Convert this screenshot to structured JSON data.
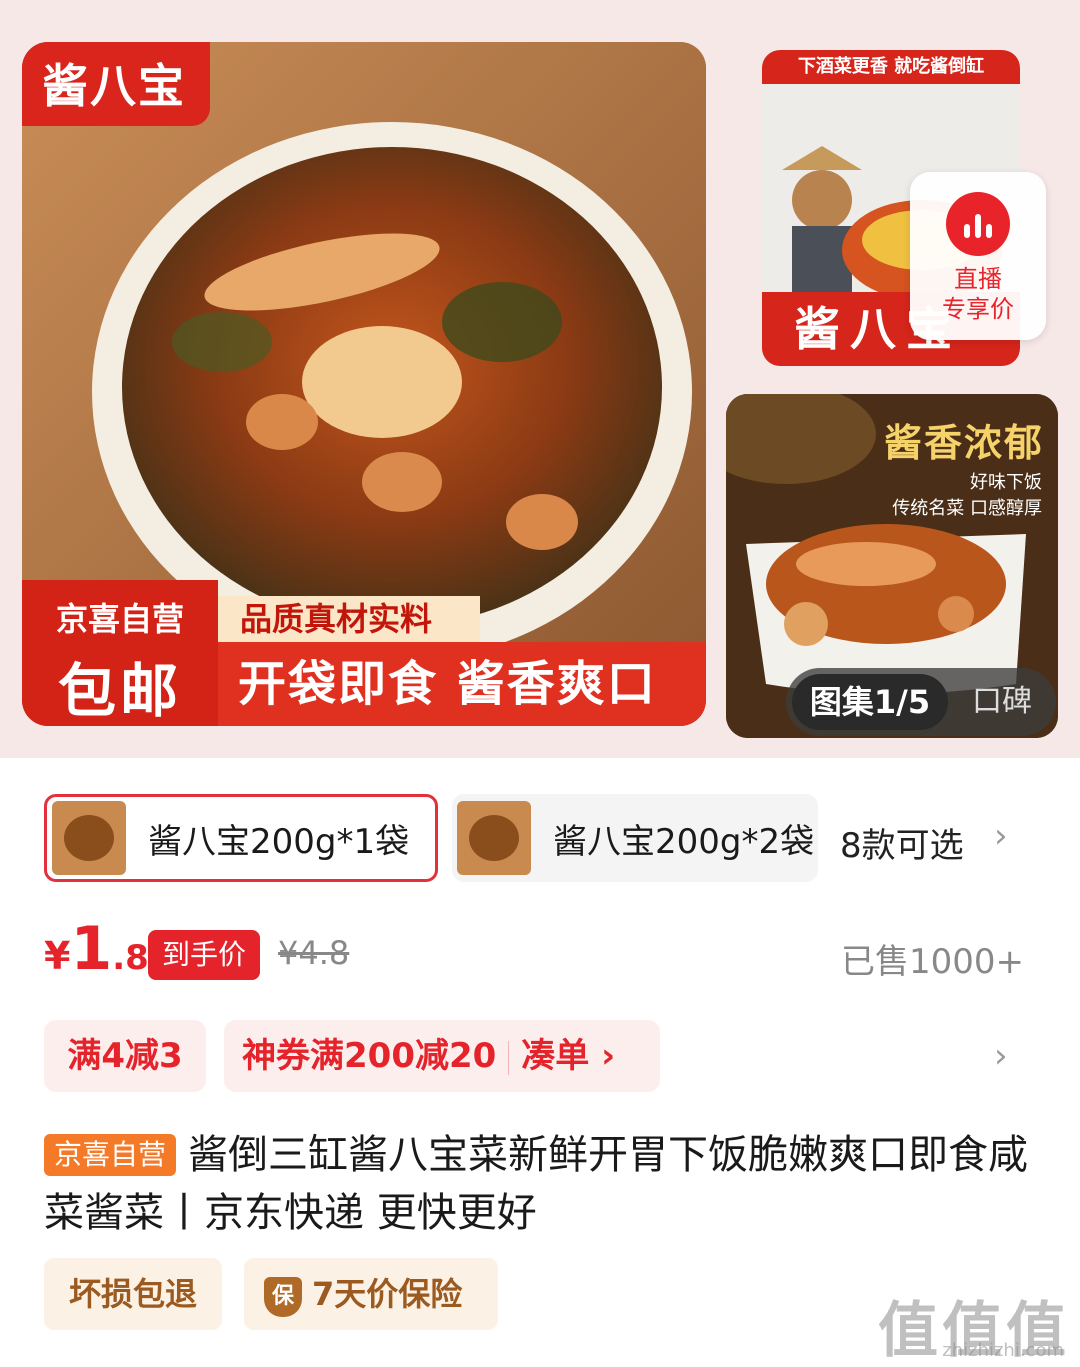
{
  "gallery": {
    "main": {
      "corner_tag": "酱八宝",
      "banner_line1": "京喜自营",
      "banner_line2": "包邮",
      "quality": "品质真材实料",
      "tagline": "开袋即食 酱香爽口"
    },
    "side1": {
      "top_strip": "下酒菜更香 就吃酱倒缸",
      "bottom_text": "酱八宝"
    },
    "live": {
      "line1": "直播",
      "line2": "专享价"
    },
    "side2": {
      "title": "酱香浓郁",
      "sub1": "好味下饭",
      "sub2": "传统名菜 口感醇厚"
    },
    "album": {
      "active": "图集1/5",
      "other": "口碑"
    }
  },
  "variants": {
    "items": [
      {
        "label": "酱八宝200g*1袋",
        "selected": true
      },
      {
        "label": "酱八宝200g*2袋",
        "selected": false
      }
    ],
    "count": "8款可选"
  },
  "price": {
    "currency": "¥",
    "integer": "1",
    "decimal": ".8",
    "tag": "到手价",
    "original": "¥4.8",
    "sold": "已售1000+"
  },
  "coupons": {
    "c1": "满4减3",
    "c2": "神券满200减20",
    "c2_action": "凑单"
  },
  "title": {
    "badge": "京喜自营",
    "text": "酱倒三缸酱八宝菜新鲜开胃下饭脆嫩爽口即食咸菜酱菜丨京东快递 更快更好"
  },
  "services": {
    "s1": "坏损包退",
    "s2_icon": "保",
    "s2": "7天价保险"
  },
  "watermark": {
    "text": "值值值",
    "url": "zhizhizhi.com"
  },
  "colors": {
    "accent_red": "#e4232b",
    "self_operated_orange": "#f57a28",
    "service_brown": "#9a5a20"
  }
}
